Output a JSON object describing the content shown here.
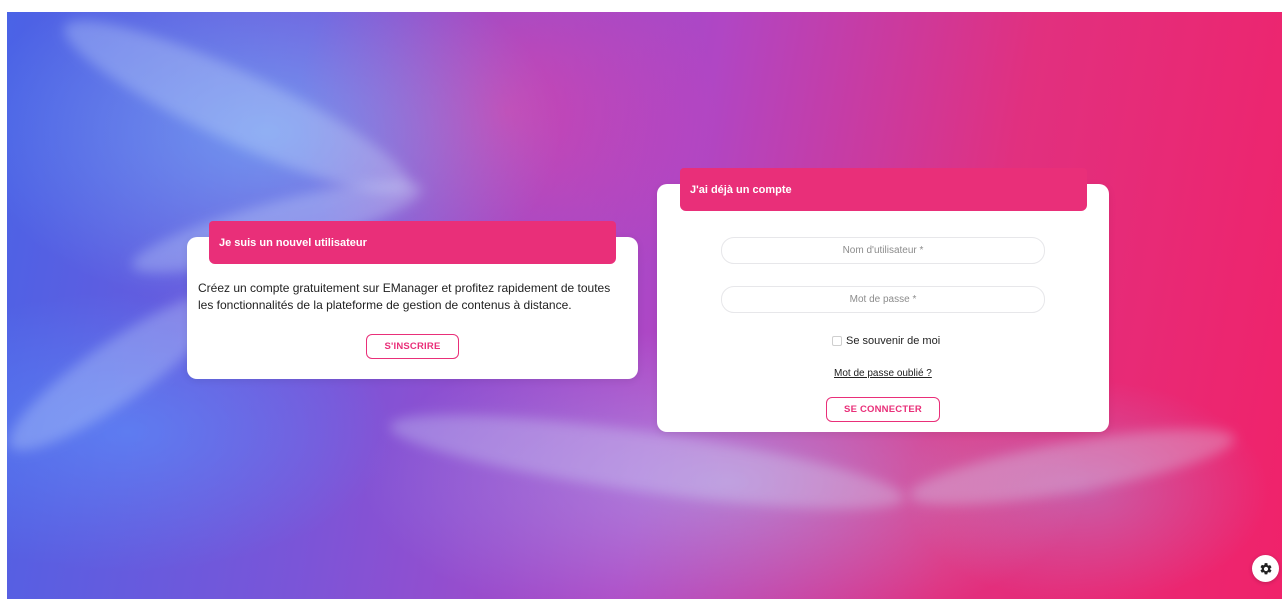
{
  "new_user": {
    "title": "Je suis un nouvel utilisateur",
    "description": "Créez un compte gratuitement sur EManager et profitez rapidement de toutes les fonctionnalités de la plateforme de gestion de contenus à distance.",
    "signup_label": "S'INSCRIRE"
  },
  "login": {
    "title": "J'ai déjà un compte",
    "username_placeholder": "Nom d'utilisateur *",
    "password_placeholder": "Mot de passe *",
    "remember_label": "Se souvenir de moi",
    "forgot_label": "Mot de passe oublié ?",
    "submit_label": "SE CONNECTER"
  },
  "settings": {
    "icon": "gear-icon"
  },
  "colors": {
    "accent": "#e92f79"
  }
}
